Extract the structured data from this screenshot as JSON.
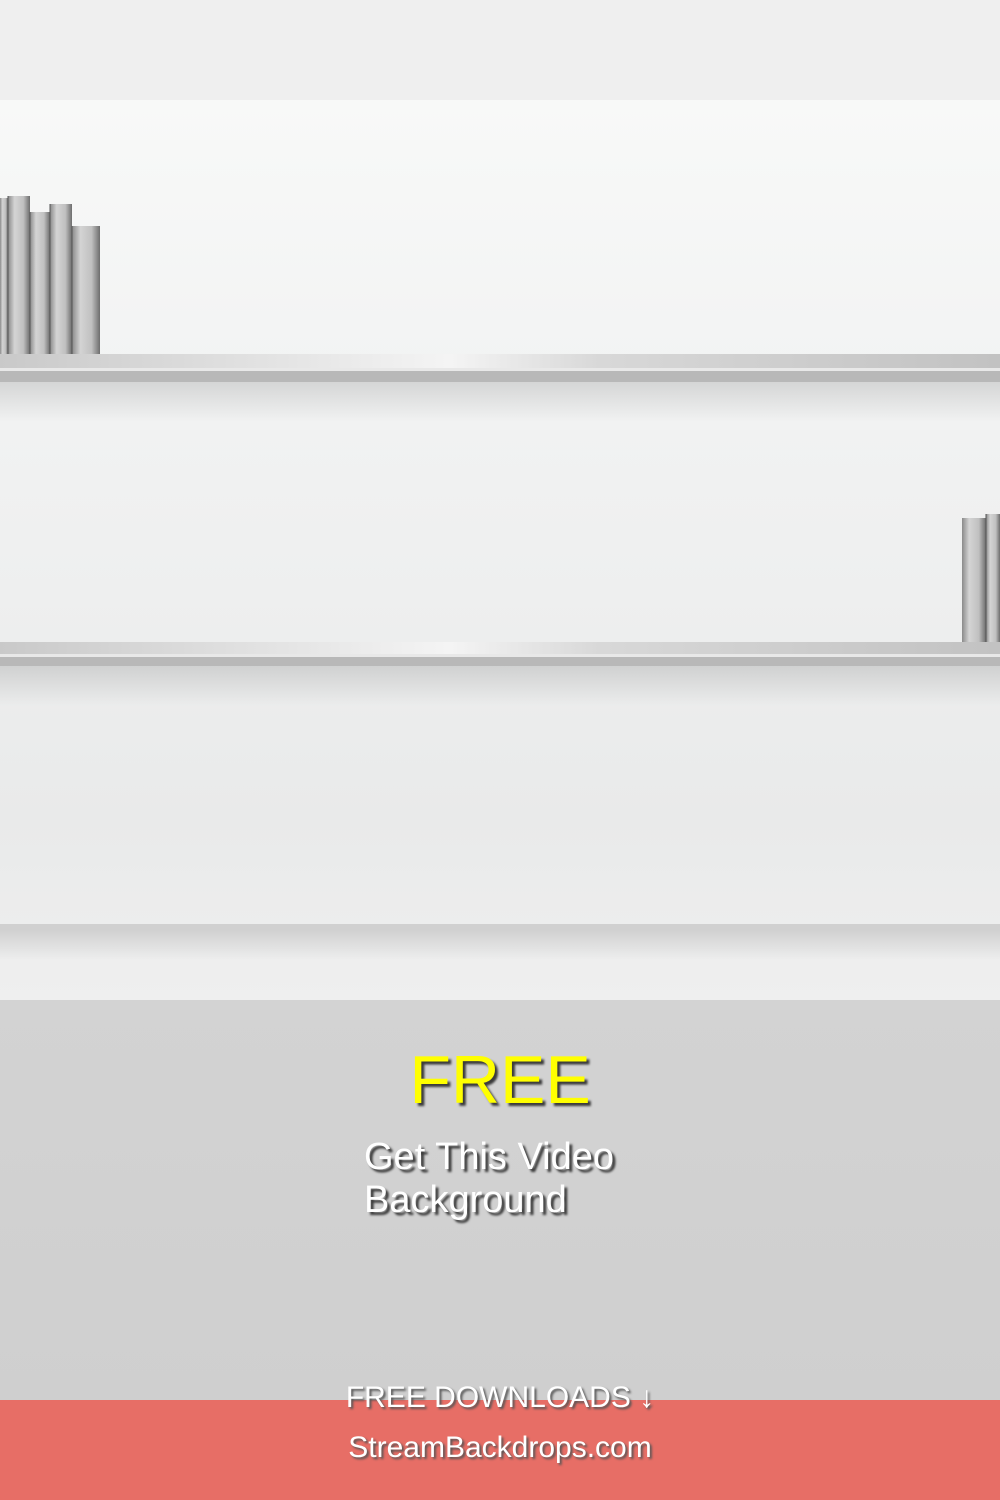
{
  "promo": {
    "headline": "FREE",
    "subtitle": "Get This Video Background"
  },
  "footer": {
    "downloads_label": "FREE DOWNLOADS ↓",
    "site": "StreamBackdrops.com"
  },
  "colors": {
    "headline": "#ffff00",
    "footer_bar": "#e76e66",
    "promo_band": "#d0d0d0"
  }
}
